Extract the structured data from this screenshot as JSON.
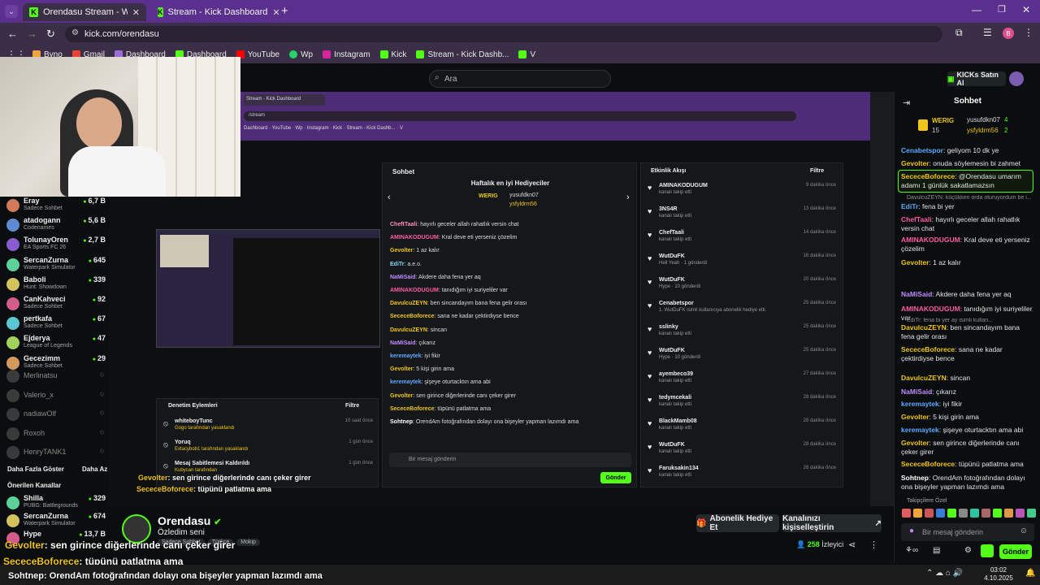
{
  "browser": {
    "tabs": [
      {
        "title": "Orendasu Stream - Watch Live o",
        "active": true
      },
      {
        "title": "Stream - Kick Dashboard",
        "active": false
      }
    ],
    "url": "kick.com/orendasu",
    "bookmarks": [
      "Byno",
      "Gmail",
      "Dashboard",
      "Dashboard",
      "YouTube",
      "Wp",
      "Instagram",
      "Kick",
      "Stream - Kick Dashb...",
      "V"
    ]
  },
  "header": {
    "search_placeholder": "Ara",
    "kicks_button": "KICKs Satın Al"
  },
  "sidebar": {
    "channels": [
      {
        "name": "Eray",
        "game": "Sadece Sohbet",
        "viewers": "6,7 B"
      },
      {
        "name": "atadogann",
        "game": "Codenames",
        "viewers": "5,6 B"
      },
      {
        "name": "TolunayOren",
        "game": "EA Sports FC 26",
        "viewers": "2,7 B"
      },
      {
        "name": "SercanZurna",
        "game": "Waterpark Simulator",
        "viewers": "645"
      },
      {
        "name": "Baboli",
        "game": "Hunt: Showdown",
        "viewers": "339"
      },
      {
        "name": "CanKahveci",
        "game": "Sadece Sohbet",
        "viewers": "92"
      },
      {
        "name": "pertkafa",
        "game": "Sadece Sohbet",
        "viewers": "67"
      },
      {
        "name": "Ejderya",
        "game": "League of Legends",
        "viewers": "47"
      },
      {
        "name": "Gecezimm",
        "game": "Sadece Sohbet",
        "viewers": "29"
      }
    ],
    "offline": [
      "Merlinatsu",
      "Valerio_x",
      "nadiawOlf",
      "Roxoh",
      "HenryTANK1"
    ],
    "show_more": "Daha Fazla Göster",
    "show_less": "Daha Az",
    "recommended_title": "Önerilen Kanallar",
    "recommended": [
      {
        "name": "Shilla",
        "game": "PUBG: Battlegrounds",
        "viewers": "329"
      },
      {
        "name": "SercanZurna",
        "game": "Waterpark Simulator",
        "viewers": "674"
      },
      {
        "name": "Hype",
        "game": "",
        "viewers": "13,7 B"
      }
    ]
  },
  "inner": {
    "tab": "Stream - Kick Dashboard",
    "chat_title": "Sohbet",
    "weekly": "Haftalık en iyi Hediyeciler",
    "gifters": [
      "WERIG",
      "yusufdkn07",
      "ysfyldrm56"
    ],
    "events_title": "Etkinlik Akışı",
    "filter": "Filtre",
    "modlog_title": "Denetim Eylemleri",
    "chat_input": "Bir mesaj gönderin",
    "send": "Gönder",
    "chat_lines": [
      {
        "u": "CheftTaali",
        "m": "hayırlı geceler allah rahatlık versin chat"
      },
      {
        "u": "AMINAKODUGUM",
        "m": "Kral deve eti yerseniz çözelim"
      },
      {
        "u": "Gevolter",
        "m": "1 az kalır"
      },
      {
        "u": "EdiTr",
        "m": "a.e.o."
      },
      {
        "u": "NaMiSaid",
        "m": "Akdere daha fena yer aq"
      },
      {
        "u": "AMINAKODUGUM",
        "m": "tanıdığım iyi suriyeliler var"
      },
      {
        "u": "DavulcuZEYN",
        "m": "ben sincandayım bana fena gelir orası"
      },
      {
        "u": "SececeBoforece",
        "m": "sana ne kadar çektirdiyse bence"
      },
      {
        "u": "DavulcuZEYN",
        "m": "sincan"
      },
      {
        "u": "NaMiSaid",
        "m": "çıkarız"
      },
      {
        "u": "keremaytek",
        "m": "iyi fikir"
      },
      {
        "u": "Gevolter",
        "m": "5 kişi girin ama"
      },
      {
        "u": "keremaytek",
        "m": "şişeye oturtacktın ama abi"
      },
      {
        "u": "Gevolter",
        "m": "sen girince diğerlerinde canı çeker girer"
      },
      {
        "u": "SececeBoforece",
        "m": "tüpünü patlatma ama"
      },
      {
        "u": "Sohtnep",
        "m": "OrendAm fotoğrafından dolayı ona bişeyler yapman lazımdı ama"
      }
    ],
    "events": [
      {
        "name": "AMINAKODUGUM",
        "sub": "kanalı takip etti",
        "time": "9 dakika önce"
      },
      {
        "name": "3NS4R",
        "sub": "kanalı takip etti",
        "time": "13 dakika önce"
      },
      {
        "name": "ChefTaali",
        "sub": "kanalı takip etti",
        "time": "14 dakika önce"
      },
      {
        "name": "WutDuFK",
        "sub": "Hell Yeah · 1 gönderdi",
        "time": "16 dakika önce"
      },
      {
        "name": "WutDuFK",
        "sub": "Hype · 10 gönderdi",
        "time": "20 dakika önce"
      },
      {
        "name": "Cenabetspor",
        "sub": "1. WutDuFK isimli kullanıcıya abonelik hediye etti.",
        "time": "25 dakika önce"
      },
      {
        "name": "sslinky",
        "sub": "kanalı takip etti",
        "time": "25 dakika önce"
      },
      {
        "name": "WutDuFK",
        "sub": "Hype · 10 gönderdi",
        "time": "25 dakika önce"
      },
      {
        "name": "ayembeco39",
        "sub": "kanalı takip etti",
        "time": "27 dakika önce"
      },
      {
        "name": "tedymcekali",
        "sub": "kanalı takip etti",
        "time": "28 dakika önce"
      },
      {
        "name": "BlackMamb08",
        "sub": "kanalı takip etti",
        "time": "28 dakika önce"
      },
      {
        "name": "WutDuFK",
        "sub": "kanalı takip etti",
        "time": "28 dakika önce"
      },
      {
        "name": "Faruksakin134",
        "sub": "kanalı takip etti",
        "time": "28 dakika önce"
      }
    ],
    "modlog": [
      {
        "name": "whiteboyTunc",
        "sub": "Gogo tarafından yasaklandı",
        "time": "10 saat önce"
      },
      {
        "name": "Yoruq",
        "sub": "Extacybob1 tarafından yasaklandı",
        "time": "1 gün önce"
      },
      {
        "name": "Mesaj Sabitlemesi Kaldırıldı",
        "sub": "Kubycan tarafından",
        "time": "1 gün önce"
      }
    ]
  },
  "overlay": {
    "line1_user": "Gevolter",
    "line1_msg": ": sen girince diğerlerinde canı çeker girer",
    "line2_user": "SececeBoforece",
    "line2_msg": ": tüpünü patlatma ama",
    "line3_user": "Sohtnep",
    "line3_msg": ": OrendAm fotoğrafından dolayı ona bişeyler yapman lazımdı ama"
  },
  "streamer": {
    "name": "Orendasu",
    "title": "Özledim seni",
    "tags": [
      "Sadece Sohbet",
      "Türkçe",
      "Mokip"
    ],
    "gift_button": "Abonelik Hediye Et",
    "customize_button": "Kanalınızı kişiselleştirin",
    "viewers": "258",
    "viewers_label": "İzleyici"
  },
  "chat": {
    "title": "Sohbet",
    "gifters": [
      {
        "name": "WERIG",
        "count": "15"
      },
      {
        "name": "yusufdkn07",
        "count": "4"
      },
      {
        "name": "ysfyldrm56",
        "count": "2"
      }
    ],
    "pinned": {
      "u": "SececeBoforece",
      "m": ": @Orendasu umarım adamı 1 günlük sakatlamazsın"
    },
    "reply_hint": "DavulcuZEYN: küçükken orda oturuyordum be i...",
    "messages": [
      {
        "u": "Cenabetspor",
        "m": ": geliyom 10 dk ye",
        "c": "blu"
      },
      {
        "u": "Gevolter",
        "m": ": onuda söylemesin bi zahmet",
        "c": "ylw"
      },
      {
        "u": "EdiTr",
        "m": ": fena bi yer",
        "c": "blu"
      },
      {
        "u": "ChefTaali",
        "m": ": hayırlı geceler allah rahatlık versin chat",
        "c": "pink"
      },
      {
        "u": "AMINAKODUGUM",
        "m": ": Kral deve eti yerseniz çözelim",
        "c": "pink"
      },
      {
        "u": "Gevolter",
        "m": ": 1 az kalır",
        "c": "ylw"
      },
      {
        "u": "NaMiSaid",
        "m": ": Akdere daha fena yer aq",
        "c": "pur"
      },
      {
        "u": "AMINAKODUGUM",
        "m": ": tanıdığım iyi suriyeliler var",
        "c": "pink"
      },
      {
        "u": "DavulcuZEYN",
        "m": ": ben sincandayım bana fena gelir orası",
        "c": "ylw"
      },
      {
        "u": "SececeBoforece",
        "m": ": sana ne kadar çektirdiyse bence",
        "c": "ylw"
      },
      {
        "u": "DavulcuZEYN",
        "m": ": sincan",
        "c": "ylw"
      },
      {
        "u": "NaMiSaid",
        "m": ": çıkarız",
        "c": "pur"
      },
      {
        "u": "keremaytek",
        "m": ": iyi fikir",
        "c": "blu"
      },
      {
        "u": "Gevolter",
        "m": ": 5 kişi girin ama",
        "c": "ylw"
      },
      {
        "u": "keremaytek",
        "m": ": şişeye oturtacktın ama abi",
        "c": "blu"
      },
      {
        "u": "Gevolter",
        "m": ": sen girince diğerlerinde canı çeker girer",
        "c": "ylw"
      },
      {
        "u": "SececeBoforece",
        "m": ": tüpünü patlatma ama",
        "c": "ylw"
      },
      {
        "u": "Sohtnep",
        "m": ": OrendAm fotoğrafından dolayı ona bişeyler yapman lazımdı ama",
        "c": "wht"
      }
    ],
    "small_lines": [
      "EdiTr: fena bi yer ay isimli kullan...",
      "EdiTr: a.e.o."
    ],
    "followers_only": "Takipçilere Özel",
    "input_placeholder": "Bir mesaj gönderin",
    "send": "Gönder"
  },
  "taskbar": {
    "time": "03:02",
    "date": "4.10.2025"
  },
  "colors": {
    "kick_green": "#53fc18",
    "tab_purple": "#5b2f8d",
    "bg": "#0b0e0f"
  }
}
